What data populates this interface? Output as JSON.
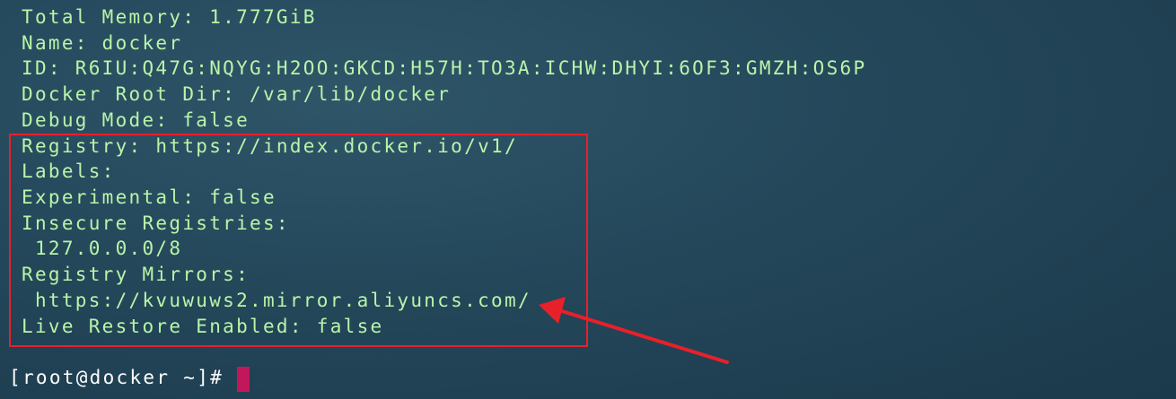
{
  "terminal": {
    "lines": [
      "Total Memory: 1.777GiB",
      "Name: docker",
      "ID: R6IU:Q47G:NQYG:H2OO:GKCD:H57H:TO3A:ICHW:DHYI:6OF3:GMZH:OS6P",
      "Docker Root Dir: /var/lib/docker",
      "Debug Mode: false",
      "Registry: https://index.docker.io/v1/",
      "Labels:",
      "Experimental: false",
      "Insecure Registries:",
      " 127.0.0.0/8",
      "Registry Mirrors:",
      " https://kvuwuws2.mirror.aliyuncs.com/",
      "Live Restore Enabled: false"
    ],
    "prompt": "[root@docker ~]# "
  },
  "colors": {
    "output_text": "#b8f5a8",
    "prompt_text": "#ffffff",
    "annotation_red": "#e8202a",
    "cursor": "#c2185b",
    "background": "#24475a"
  }
}
